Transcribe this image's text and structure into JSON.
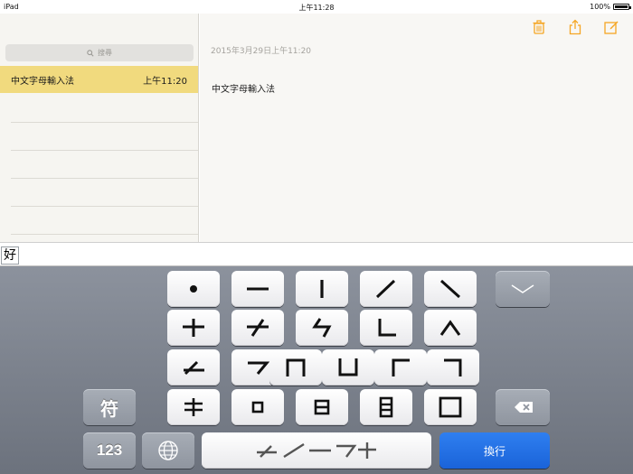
{
  "status_bar": {
    "device": "iPad",
    "time": "上午11:28",
    "battery": "100%"
  },
  "sidebar": {
    "search_placeholder": "搜尋",
    "notes": [
      {
        "title": "中文字母輸入法",
        "time": "上午11:20"
      }
    ]
  },
  "note": {
    "date": "2015年3月29日上午11:20",
    "body": "中文字母輸入法",
    "toolbar_icons": [
      "trash-icon",
      "share-icon",
      "compose-icon"
    ]
  },
  "candidate_bar": {
    "candidates": [
      "好"
    ]
  },
  "keyboard": {
    "symbols_key": "符",
    "numbers_key": "123",
    "enter_key": "換行",
    "space_key_strokes": "㇀㇐㇇十",
    "colors": {
      "accent": "#f5a623",
      "enter": "#1f6fe5",
      "selected_note": "#f1da7e"
    }
  }
}
